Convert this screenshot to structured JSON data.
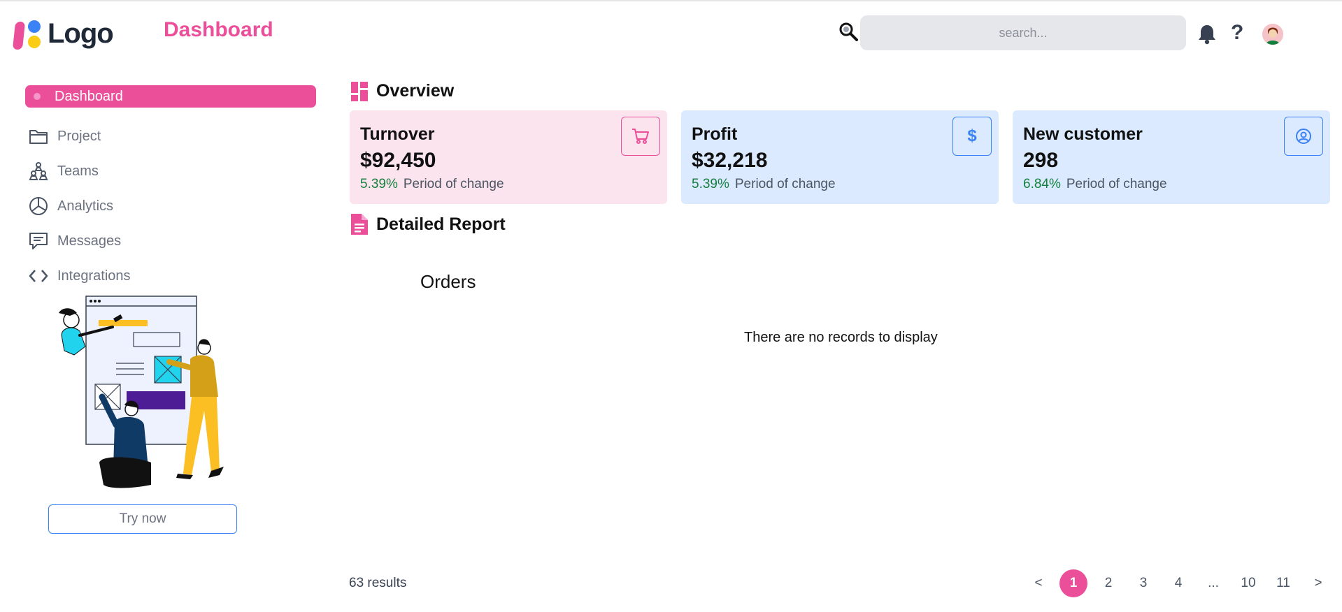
{
  "header": {
    "logo_text": "Logo",
    "page_title": "Dashboard",
    "search_placeholder": "search...",
    "help_label": "?"
  },
  "sidebar": {
    "items": [
      {
        "label": "Dashboard",
        "icon": "dashboard-dot-icon",
        "active": true
      },
      {
        "label": "Project",
        "icon": "folder-icon"
      },
      {
        "label": "Teams",
        "icon": "teams-icon"
      },
      {
        "label": "Analytics",
        "icon": "pie-chart-icon"
      },
      {
        "label": "Messages",
        "icon": "message-icon"
      },
      {
        "label": "Integrations",
        "icon": "code-icon"
      }
    ],
    "cta_label": "Try now"
  },
  "overview": {
    "title": "Overview",
    "cards": [
      {
        "title": "Turnover",
        "value": "$92,450",
        "change": "5.39%",
        "change_label": "Period of change",
        "icon": "cart-icon",
        "accent": "#ec4f9a"
      },
      {
        "title": "Profit",
        "value": "$32,218",
        "change": "5.39%",
        "change_label": "Period of change",
        "icon": "dollar-icon",
        "accent": "#3b82f6"
      },
      {
        "title": "New customer",
        "value": "298",
        "change": "6.84%",
        "change_label": "Period of change",
        "icon": "user-circle-icon",
        "accent": "#3b82f6"
      }
    ]
  },
  "report": {
    "title": "Detailed Report",
    "table_title": "Orders",
    "empty_message": "There are no records to display"
  },
  "pagination": {
    "results": "63 results",
    "prev": "<",
    "next": ">",
    "pages": [
      "1",
      "2",
      "3",
      "4",
      "...",
      "10",
      "11"
    ],
    "current": "1"
  },
  "colors": {
    "primary": "#ec4f9a",
    "accent_blue": "#3b82f6",
    "card_pink": "#fce4ef",
    "card_blue": "#dbeafe",
    "positive": "#15803d"
  }
}
